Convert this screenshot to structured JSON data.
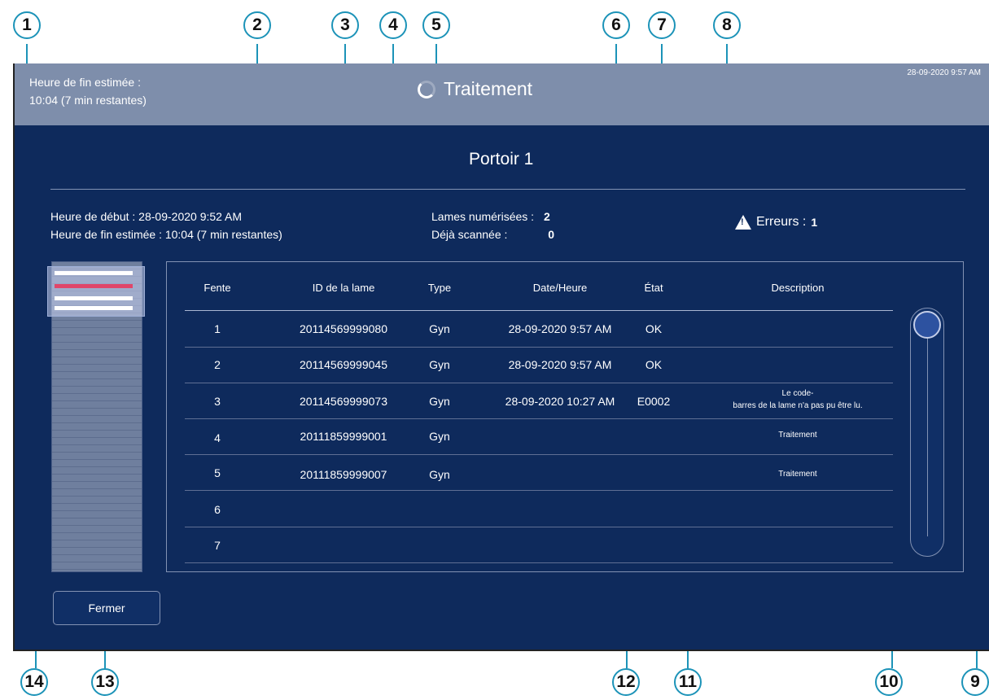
{
  "header": {
    "eta_label": "Heure de fin estimée :",
    "eta_value": "10:04 (7 min restantes)",
    "title": "Traitement",
    "clock": "28-09-2020 9:57 AM"
  },
  "rack_title": "Portoir 1",
  "info": {
    "start": "Heure de début : 28-09-2020 9:52 AM",
    "end": "Heure de fin estimée : 10:04 (7 min restantes)",
    "scanned_label": "Lames numérisées :",
    "scanned_value": "2",
    "already_label": "Déjà scannée :",
    "already_value": "0",
    "errors_label": "Erreurs :",
    "errors_value": "1"
  },
  "table": {
    "headers": [
      "Fente",
      "ID de la lame",
      "Type",
      "Date/Heure",
      "État",
      "Description"
    ],
    "rows": [
      {
        "slot": "1",
        "id": "20114569999080",
        "type": "Gyn",
        "datetime": "28-09-2020 9:57 AM",
        "state": "OK",
        "desc1": "",
        "desc2": ""
      },
      {
        "slot": "2",
        "id": "20114569999045",
        "type": "Gyn",
        "datetime": "28-09-2020 9:57 AM",
        "state": "OK",
        "desc1": "",
        "desc2": ""
      },
      {
        "slot": "3",
        "id": "20114569999073",
        "type": "Gyn",
        "datetime": "28-09-2020 10:27 AM",
        "state": "E0002",
        "desc1": "Le code-",
        "desc2": "barres de la lame n'a pas pu être lu."
      },
      {
        "slot": "4",
        "id": "20111859999001",
        "type": "Gyn",
        "datetime": "",
        "state": "",
        "desc1": "Traitement",
        "desc2": ""
      },
      {
        "slot": "5",
        "id": "20111859999007",
        "type": "Gyn",
        "datetime": "",
        "state": "",
        "desc1": "Traitement",
        "desc2": ""
      },
      {
        "slot": "6",
        "id": "",
        "type": "",
        "datetime": "",
        "state": "",
        "desc1": "",
        "desc2": ""
      },
      {
        "slot": "7",
        "id": "",
        "type": "",
        "datetime": "",
        "state": "",
        "desc1": "",
        "desc2": ""
      }
    ]
  },
  "close_button": "Fermer",
  "rack_lines": [
    {
      "color": "#ffffff"
    },
    {
      "color": "#e0466a"
    },
    {
      "color": "#ffffff"
    },
    {
      "color": "#ffffff"
    }
  ],
  "callouts": [
    "1",
    "2",
    "3",
    "4",
    "5",
    "6",
    "7",
    "8",
    "9",
    "10",
    "11",
    "12",
    "13",
    "14"
  ],
  "colors": {
    "background": "#0e2a5c",
    "header": "#7e8eab",
    "callout": "#1c93b8",
    "error_line": "#e0466a"
  },
  "icons": [
    "spinner-icon",
    "warning-icon"
  ]
}
